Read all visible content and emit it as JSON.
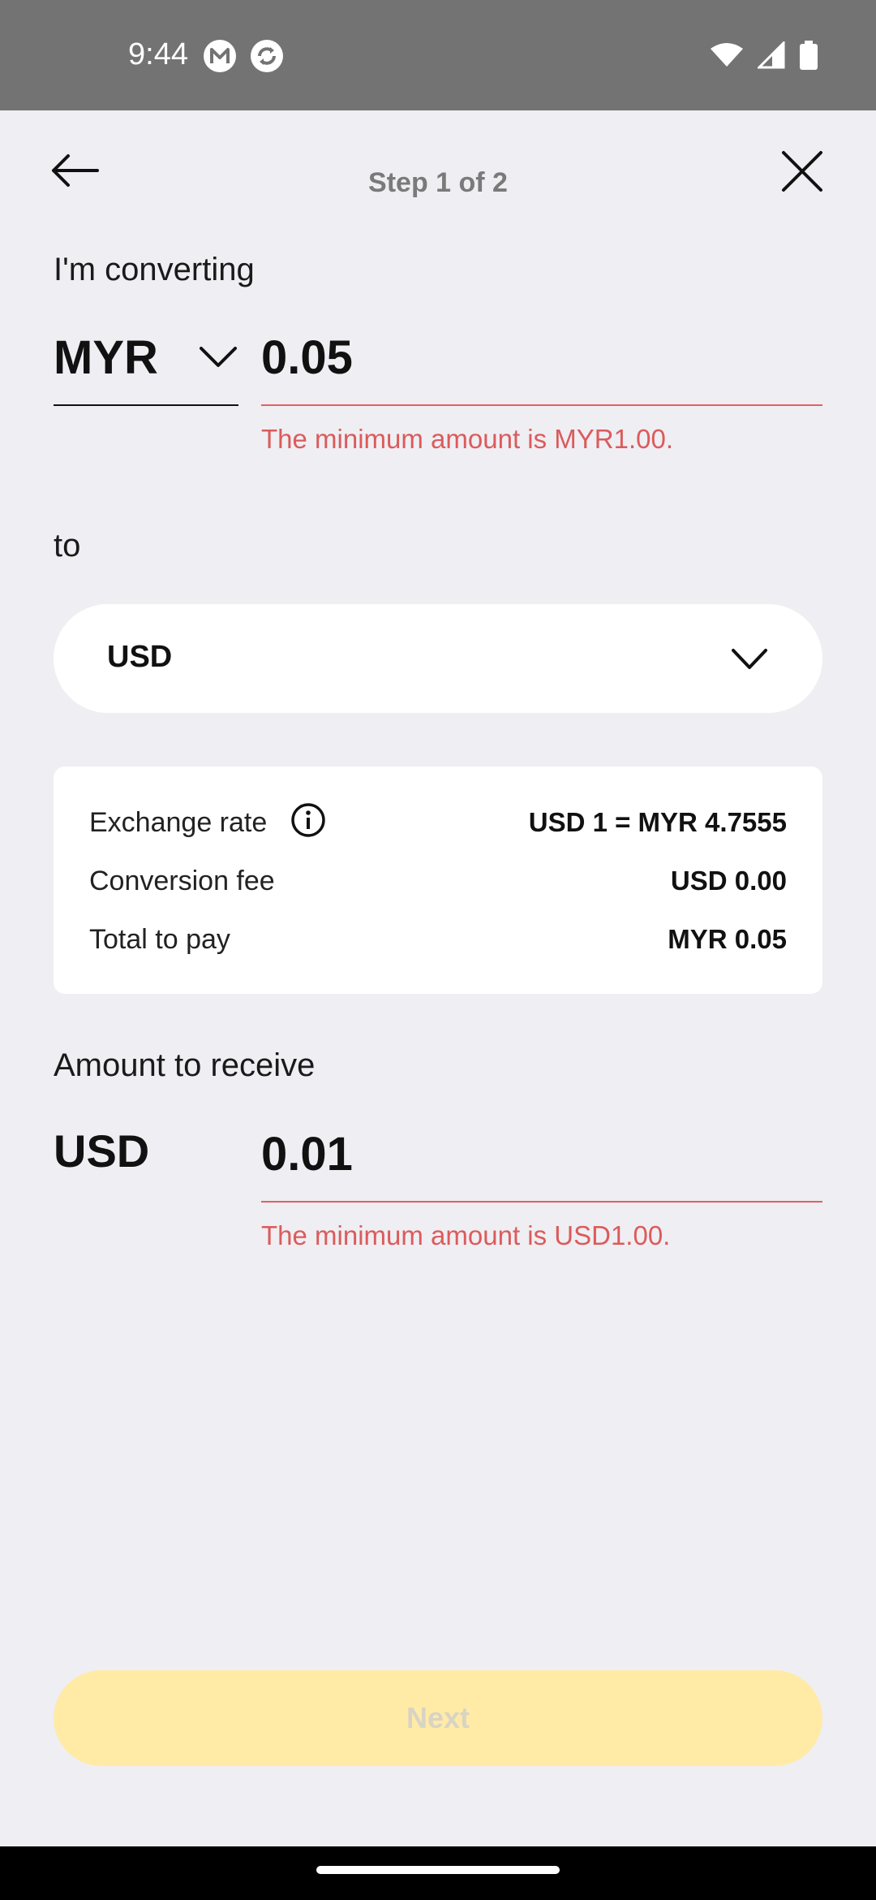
{
  "status_bar": {
    "time": "9:44",
    "icons": [
      "gmail-m-icon",
      "sync-app-icon",
      "wifi-icon",
      "signal-icon",
      "battery-icon"
    ]
  },
  "header": {
    "step_title": "Step 1 of 2",
    "back_icon": "arrow-left-icon",
    "close_icon": "close-icon"
  },
  "from": {
    "label": "I'm converting",
    "currency": "MYR",
    "amount": "0.05",
    "error": "The minimum amount is MYR1.00."
  },
  "to": {
    "label": "to",
    "currency": "USD"
  },
  "rate_card": {
    "rows": [
      {
        "label": "Exchange rate",
        "value": "USD 1 = MYR 4.7555"
      },
      {
        "label": "Conversion fee",
        "value": "USD 0.00"
      },
      {
        "label": "Total to pay",
        "value": "MYR 0.05"
      }
    ]
  },
  "receive": {
    "label": "Amount to receive",
    "currency": "USD",
    "amount": "0.01",
    "error": "The minimum amount is USD1.00."
  },
  "actions": {
    "next_label": "Next"
  },
  "colors": {
    "background": "#EFEEF3",
    "error": "#DB5B5B",
    "next_disabled_bg": "#FFEBA6",
    "status_bar": "#737373"
  }
}
